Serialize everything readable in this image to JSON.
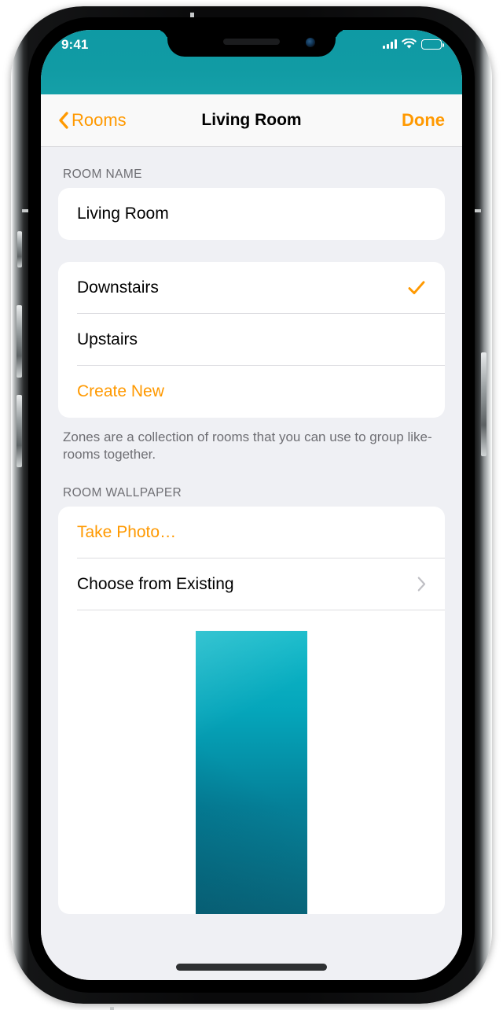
{
  "status_bar": {
    "time": "9:41",
    "signal_icon": "cellular-signal-icon",
    "wifi_icon": "wifi-icon",
    "battery_icon": "battery-full-icon"
  },
  "nav": {
    "back_label": "Rooms",
    "back_icon": "chevron-left-icon",
    "title": "Living Room",
    "done_label": "Done"
  },
  "sections": {
    "room_name": {
      "header": "ROOM NAME",
      "value": "Living Room",
      "placeholder": "Room Name"
    },
    "zones": {
      "items": [
        {
          "label": "Downstairs",
          "checked": true,
          "accessory": "checkmark-icon",
          "style": "default"
        },
        {
          "label": "Upstairs",
          "checked": false,
          "accessory": "none",
          "style": "default"
        },
        {
          "label": "Create New",
          "checked": false,
          "accessory": "none",
          "style": "action"
        }
      ],
      "footnote": "Zones are a collection of rooms that you can use to group like-rooms together."
    },
    "wallpaper": {
      "header": "ROOM WALLPAPER",
      "items": [
        {
          "label": "Take Photo…",
          "accessory": "none",
          "style": "action"
        },
        {
          "label": "Choose from Existing",
          "accessory": "chevron-right-icon",
          "style": "default"
        }
      ],
      "preview_alt": "room-wallpaper-preview"
    }
  },
  "colors": {
    "accent_orange": "#ff9900",
    "status_teal": "#119ba4",
    "group_background": "#eff0f4",
    "card_white": "#ffffff",
    "secondary_text": "#6e6e73",
    "separator": "#dcdce0",
    "wallpaper_top": "#0fb9c9",
    "wallpaper_bottom": "#0a6c80"
  }
}
